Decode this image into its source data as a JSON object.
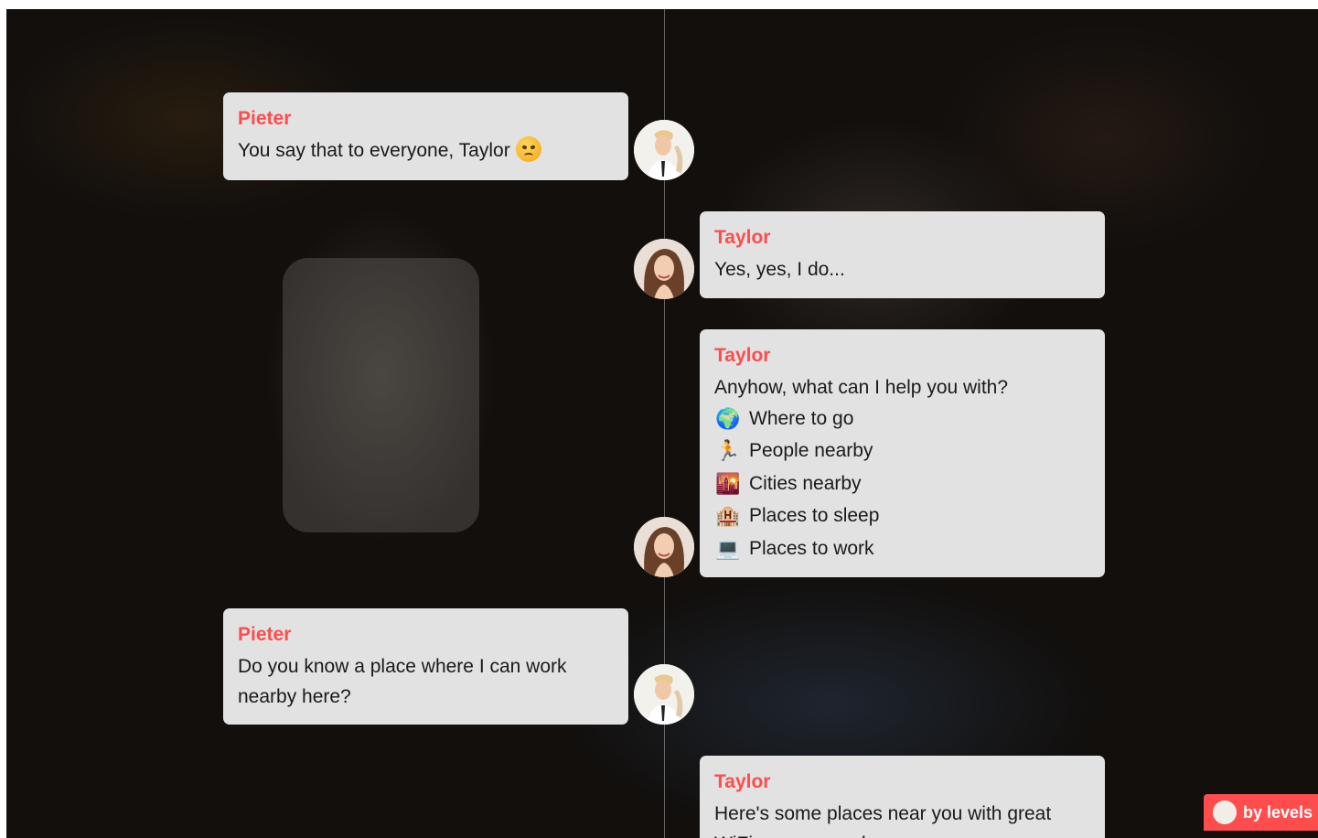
{
  "messages": [
    {
      "sender": "Pieter",
      "side": "left",
      "text": "You say that to everyone, Taylor",
      "emoji": "angry-face-icon"
    },
    {
      "sender": "Taylor",
      "side": "right",
      "text": "Yes, yes, I do..."
    },
    {
      "sender": "Taylor",
      "side": "right",
      "text": "Anyhow, what can I help you with?",
      "options": [
        {
          "icon": "globe-icon",
          "glyph": "🌍",
          "label": "Where to go"
        },
        {
          "icon": "runner-icon",
          "glyph": "🏃",
          "label": "People nearby"
        },
        {
          "icon": "city-sunset-icon",
          "glyph": "🌇",
          "label": "Cities nearby"
        },
        {
          "icon": "hotel-icon",
          "glyph": "🏨",
          "label": "Places to sleep"
        },
        {
          "icon": "laptop-icon",
          "glyph": "💻",
          "label": "Places to work"
        }
      ]
    },
    {
      "sender": "Pieter",
      "side": "left",
      "text_line1": "Do you know a place where I can work",
      "text_line2": "nearby here?"
    },
    {
      "sender": "Taylor",
      "side": "right",
      "text_line1": "Here's some places near you with great",
      "text_line2": "WiFi you can work:"
    }
  ],
  "badge": {
    "label": "by levels"
  },
  "colors": {
    "accent": "#ff4c4c",
    "bubble": "#e2e2e2"
  }
}
